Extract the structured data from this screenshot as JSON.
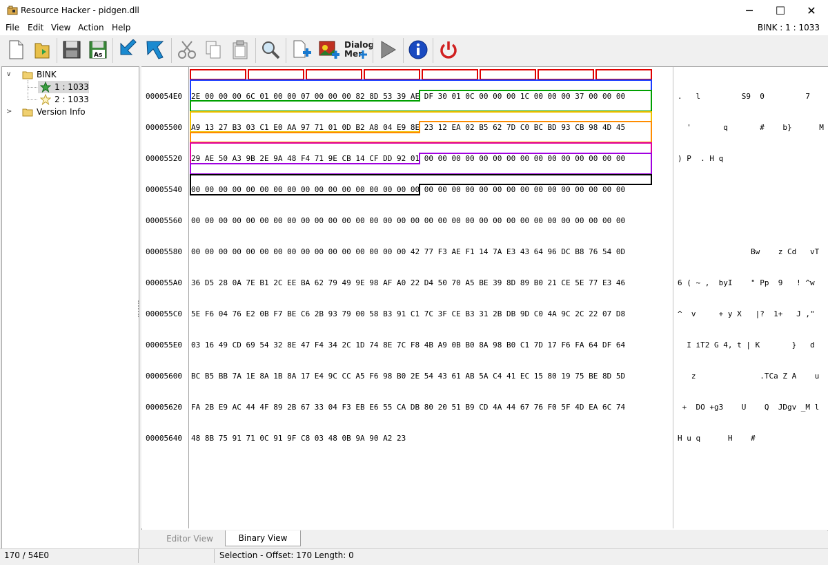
{
  "window": {
    "title": "Resource Hacker - pidgen.dll",
    "minimize_glyph": "─",
    "maximize_glyph": "☐",
    "close_glyph": "✕"
  },
  "menu": [
    "File",
    "Edit",
    "View",
    "Action",
    "Help"
  ],
  "resource_label": "BINK : 1 : 1033",
  "toolbar": {
    "dialog_menu_label_1": "Dialog",
    "dialog_menu_label_2": "Mer"
  },
  "tree": {
    "root": "BINK",
    "children": [
      "1 : 1033",
      "2 : 1033"
    ],
    "version": "Version Info"
  },
  "hex": {
    "addresses": [
      "000054E0",
      "00005500",
      "00005520",
      "00005540",
      "00005560",
      "00005580",
      "000055A0",
      "000055C0",
      "000055E0",
      "00005600",
      "00005620",
      "00005640"
    ],
    "rows": [
      "2E 00 00 00 6C 01 00 00 07 00 00 00 82 8D 53 39 AE DF 30 01 0C 00 00 00 1C 00 00 00 37 00 00 00",
      "A9 13 27 B3 03 C1 E0 AA 97 71 01 0D B2 A8 04 E9 8E 23 12 EA 02 B5 62 7D C0 BC BD 93 CB 98 4D 45",
      "29 AE 50 A3 9B 2E 9A 48 F4 71 9E CB 14 CF DD 92 01 00 00 00 00 00 00 00 00 00 00 00 00 00 00 00",
      "00 00 00 00 00 00 00 00 00 00 00 00 00 00 00 00 00 00 00 00 00 00 00 00 00 00 00 00 00 00 00 00",
      "00 00 00 00 00 00 00 00 00 00 00 00 00 00 00 00 00 00 00 00 00 00 00 00 00 00 00 00 00 00 00 00",
      "00 00 00 00 00 00 00 00 00 00 00 00 00 00 00 00 42 77 F3 AE F1 14 7A E3 43 64 96 DC B8 76 54 0D",
      "36 D5 28 0A 7E B1 2C EE BA 62 79 49 9E 98 AF A0 22 D4 50 70 A5 BE 39 8D 89 B0 21 CE 5E 77 E3 46",
      "5E F6 04 76 E2 0B F7 BE C6 2B 93 79 00 58 B3 91 C1 7C 3F CE B3 31 2B DB 9D C0 4A 9C 2C 22 07 D8",
      "03 16 49 CD 69 54 32 8E 47 F4 34 2C 1D 74 8E 7C F8 4B A9 0B B0 8A 98 B0 C1 7D 17 F6 FA 64 DF 64",
      "BC B5 BB 7A 1E 8A 1B 8A 17 E4 9C CC A5 F6 98 B0 2E 54 43 61 AB 5A C4 41 EC 15 80 19 75 BE 8D 5D",
      "FA 2B E9 AC 44 4F 89 2B 67 33 04 F3 EB E6 55 CA DB 80 20 51 B9 CD 4A 44 67 76 F0 5F 4D EA 6C 74",
      "48 8B 75 91 71 0C 91 9F C8 03 48 0B 9A 90 A2 23"
    ],
    "ascii": [
      ".   l         S9  0         7",
      "  '       q       #    b}      M",
      ") P  . H q",
      "",
      "",
      "                Bw    z Cd   vT",
      "6 ( ~ ,  byI    \" Pp  9   ! ^w",
      "^  v     + y X   |?  1+   J ,\"",
      "  I iT2 G 4, t | K       }   d",
      "   z              .TCa Z A    u",
      " +  DO +g3    U    Q  JDgv _M l",
      "H u q      H    #"
    ]
  },
  "tabs": {
    "editor": "Editor View",
    "binary": "Binary View"
  },
  "status": {
    "left": "170 / 54E0",
    "right": "Selection - Offset: 170 Length: 0"
  },
  "colors": {
    "red": "#e00000",
    "blue": "#1a3cff",
    "green": "#00a000",
    "yellow": "#f0c000",
    "orange": "#ff8c00",
    "magenta": "#e000a0",
    "purple": "#a000e0",
    "black": "#000000"
  }
}
